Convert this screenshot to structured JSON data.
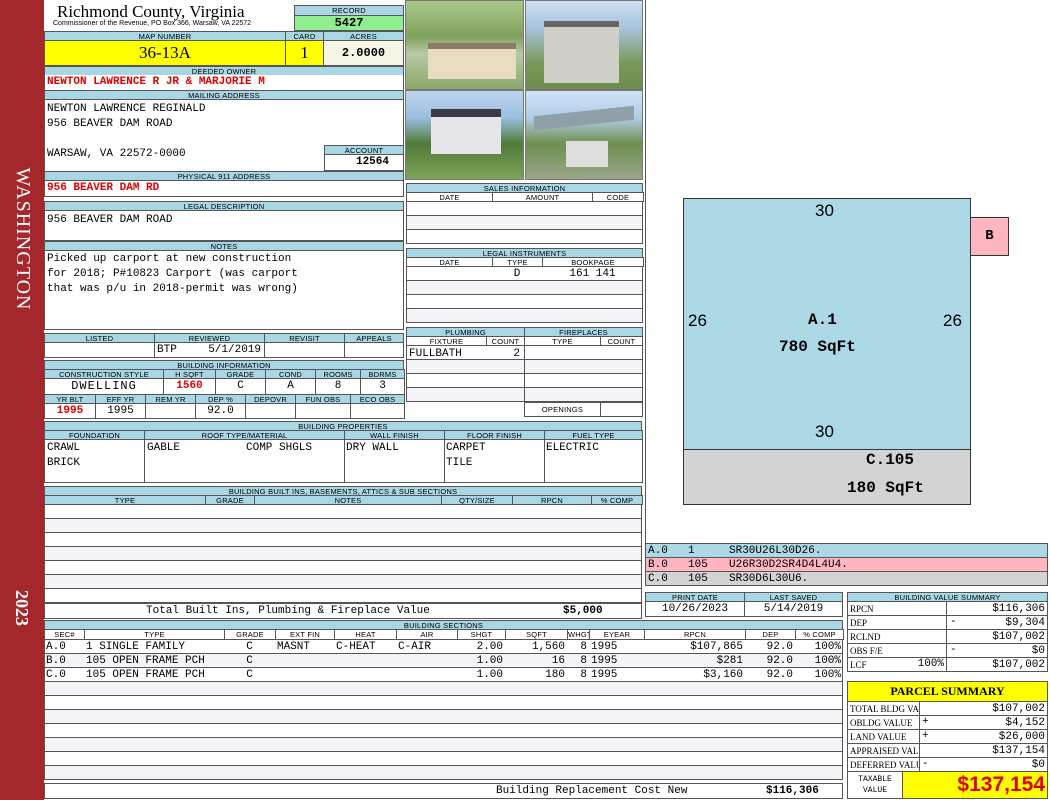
{
  "sidebar": {
    "district": "WASHINGTON",
    "year": "2023"
  },
  "header": {
    "county": "Richmond County, Virginia",
    "office": "Commissioner of the Revenue, PO Box 366, Warsaw, VA 22572",
    "record_label": "RECORD",
    "record": "5427"
  },
  "map": {
    "map_label": "MAP NUMBER",
    "map_number": "36-13A",
    "card_label": "CARD",
    "card": "1",
    "acres_label": "ACRES",
    "acres": "2.0000"
  },
  "owner": {
    "label": "DEEDED OWNER",
    "name": "NEWTON LAWRENCE R JR & MARJORIE M"
  },
  "mailing": {
    "label": "MAILING ADDRESS",
    "line1": "NEWTON LAWRENCE REGINALD",
    "line2": "956 BEAVER DAM ROAD",
    "line3": "WARSAW, VA 22572-0000",
    "account_label": "ACCOUNT",
    "account": "12564"
  },
  "physical": {
    "label": "PHYSICAL 911 ADDRESS",
    "address": "956 BEAVER DAM RD"
  },
  "legal": {
    "label": "LEGAL DESCRIPTION",
    "text": "956 BEAVER DAM ROAD"
  },
  "notes": {
    "label": "NOTES",
    "lines": [
      "Picked up carport at new construction",
      "for 2018; P#10823 Carport (was carport",
      "that was p/u in 2018-permit was wrong)"
    ]
  },
  "review": {
    "listed_label": "LISTED",
    "reviewed_label": "REVIEWED",
    "revisit_label": "REVISIT",
    "appeals_label": "APPEALS",
    "reviewed_by": "BTP",
    "reviewed_date": "5/1/2019"
  },
  "building_info": {
    "label": "BUILDING INFORMATION",
    "h1": [
      "CONSTRUCTION STYLE",
      "H SQFT",
      "GRADE",
      "COND",
      "ROOMS",
      "BDRMS"
    ],
    "v1": [
      "DWELLING",
      "1560",
      "C",
      "A",
      "8",
      "3"
    ],
    "h2": [
      "YR BLT",
      "EFF YR",
      "REM YR",
      "DEP %",
      "DEPOVR",
      "FUN OBS",
      "ECO OBS"
    ],
    "v2": [
      "1995",
      "1995",
      "",
      "92.0",
      "",
      "",
      ""
    ]
  },
  "properties": {
    "label": "BUILDING PROPERTIES",
    "headers": [
      "FOUNDATION",
      "ROOF TYPE/MATERIAL",
      "WALL FINISH",
      "FLOOR FINISH",
      "FUEL TYPE"
    ],
    "foundation": [
      "CRAWL",
      "BRICK"
    ],
    "roof_type": "GABLE",
    "roof_material": "COMP SHGLS",
    "wall": "DRY WALL",
    "floor": [
      "CARPET",
      "TILE"
    ],
    "fuel": "ELECTRIC"
  },
  "builtins": {
    "label": "BUILDING BUILT INS, BASEMENTS, ATTICS & SUB SECTIONS",
    "headers": [
      "TYPE",
      "GRADE",
      "NOTES",
      "QTY/SIZE",
      "RPCN",
      "% COMP"
    ],
    "total_label": "Total Built Ins, Plumbing & Fireplace Value",
    "total": "$5,000"
  },
  "sales": {
    "label": "SALES INFORMATION",
    "headers": [
      "DATE",
      "AMOUNT",
      "CODE"
    ]
  },
  "instruments": {
    "label": "LEGAL INSTRUMENTS",
    "headers": [
      "DATE",
      "TYPE",
      "BOOKPAGE"
    ],
    "rows": [
      {
        "date": "",
        "type": "D",
        "bookpage": "161 141"
      }
    ]
  },
  "plumbing": {
    "label": "PLUMBING",
    "headers": [
      "FIXTURE",
      "COUNT"
    ],
    "rows": [
      {
        "fixture": "FULLBATH",
        "count": "2"
      }
    ]
  },
  "fireplaces": {
    "label": "FIREPLACES",
    "headers": [
      "TYPE",
      "COUNT"
    ],
    "openings_label": "OPENINGS"
  },
  "sketch": {
    "a_label": "A.1",
    "a_area": "780 SqFt",
    "a_top": "30",
    "a_bottom": "30",
    "a_left": "26",
    "a_right": "26",
    "b_label": "B",
    "c_label": "C.105",
    "c_area": "180 SqFt",
    "segments": [
      {
        "sec": "A.0",
        "code": "1",
        "path": "SR30U26L30D26.",
        "color": "#add8e6"
      },
      {
        "sec": "B.0",
        "code": "105",
        "path": "U26R30D2SR4D4L4U4.",
        "color": "#ffb6c1"
      },
      {
        "sec": "C.0",
        "code": "105",
        "path": "SR30D6L30U6.",
        "color": "#d3d3d3"
      }
    ]
  },
  "dates": {
    "print_label": "PRINT DATE",
    "print": "10/26/2023",
    "saved_label": "LAST SAVED",
    "saved": "5/14/2019"
  },
  "sections": {
    "label": "BUILDING SECTIONS",
    "headers": [
      "SEC#",
      "TYPE",
      "GRADE",
      "EXT FIN",
      "HEAT",
      "AIR",
      "SHGT",
      "SQFT",
      "WHGT",
      "EYEAR",
      "RPCN",
      "DEP",
      "% COMP"
    ],
    "rows": [
      [
        "A.0",
        "1 SINGLE FAMILY",
        "C",
        "MASNT",
        "C-HEAT",
        "C-AIR",
        "2.00",
        "1,560",
        "8",
        "1995",
        "$107,865",
        "92.0",
        "100%"
      ],
      [
        "B.0",
        "105 OPEN FRAME PCH",
        "C",
        "",
        "",
        "",
        "1.00",
        "16",
        "8",
        "1995",
        "$281",
        "92.0",
        "100%"
      ],
      [
        "C.0",
        "105 OPEN FRAME PCH",
        "C",
        "",
        "",
        "",
        "1.00",
        "180",
        "8",
        "1995",
        "$3,160",
        "92.0",
        "100%"
      ]
    ],
    "total_label": "Building Replacement Cost New",
    "total": "$116,306"
  },
  "value_summary": {
    "label": "BUILDING VALUE SUMMARY",
    "rows": [
      {
        "label": "RPCN",
        "sign": "",
        "pct": "",
        "value": "$116,306"
      },
      {
        "label": "DEP",
        "sign": "-",
        "pct": "",
        "value": "$9,304"
      },
      {
        "label": "RCLND",
        "sign": "",
        "pct": "",
        "value": "$107,002"
      },
      {
        "label": "OBS F/E",
        "sign": "-",
        "pct": "",
        "value": "$0"
      },
      {
        "label": "LCF",
        "sign": "",
        "pct": "100%",
        "value": "$107,002"
      }
    ]
  },
  "parcel": {
    "label": "PARCEL SUMMARY",
    "rows": [
      {
        "label": "TOTAL BLDG VALUE",
        "sign": "",
        "value": "$107,002"
      },
      {
        "label": "OBLDG VALUE",
        "sign": "+",
        "value": "$4,152"
      },
      {
        "label": "LAND VALUE",
        "sign": "+",
        "value": "$26,000"
      },
      {
        "label": "APPRAISED VALUE",
        "sign": "",
        "value": "$137,154"
      },
      {
        "label": "DEFERRED VALUE",
        "sign": "-",
        "value": "$0"
      }
    ],
    "taxable_label": "TAXABLE VALUE",
    "taxable": "$137,154"
  }
}
